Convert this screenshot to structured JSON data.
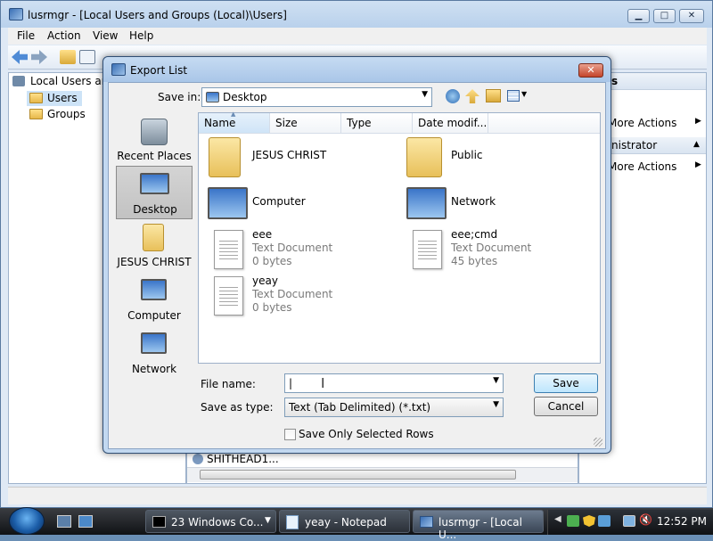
{
  "main_window": {
    "title": "lusrmgr - [Local Users and Groups (Local)\\Users]",
    "menu": [
      "File",
      "Action",
      "View",
      "Help"
    ],
    "tree": {
      "root": "Local Users and",
      "items": [
        "Users",
        "Groups"
      ]
    },
    "actions": {
      "header_1": "s",
      "more_actions_1": "More Actions",
      "header_2": "nistrator",
      "more_actions_2": "More Actions"
    },
    "center_row": "SHITHEAD1...",
    "caption_buttons": {
      "minimize": "▁",
      "maximize": "□",
      "close": "✕"
    }
  },
  "dialog": {
    "title": "Export List",
    "save_in_label": "Save in:",
    "save_in_value": "Desktop",
    "places": [
      {
        "label": "Recent Places",
        "icon": "recent-places-icon"
      },
      {
        "label": "Desktop",
        "icon": "desktop-icon",
        "selected": true
      },
      {
        "label": "JESUS CHRIST",
        "icon": "user-folder-icon"
      },
      {
        "label": "Computer",
        "icon": "computer-icon"
      },
      {
        "label": "Network",
        "icon": "network-icon"
      }
    ],
    "columns": [
      "Name",
      "Size",
      "Type",
      "Date modif..."
    ],
    "items": [
      {
        "name": "JESUS CHRIST",
        "type": "",
        "size": "",
        "icon": "user-folder-icon"
      },
      {
        "name": "Public",
        "type": "",
        "size": "",
        "icon": "folder-icon"
      },
      {
        "name": "Computer",
        "type": "",
        "size": "",
        "icon": "computer-icon"
      },
      {
        "name": "Network",
        "type": "",
        "size": "",
        "icon": "network-icon"
      },
      {
        "name": "eee",
        "type": "Text Document",
        "size": "0 bytes",
        "icon": "text-document-icon"
      },
      {
        "name": "eee;cmd",
        "type": "Text Document",
        "size": "45 bytes",
        "icon": "text-document-icon"
      },
      {
        "name": "yeay",
        "type": "Text Document",
        "size": "0 bytes",
        "icon": "text-document-icon"
      }
    ],
    "file_name_label": "File name:",
    "file_name_value": "|",
    "save_type_label": "Save as type:",
    "save_type_value": "Text (Tab Delimited) (*.txt)",
    "save_button": "Save",
    "cancel_button": "Cancel",
    "checkbox_label": "Save Only Selected Rows",
    "checkbox_checked": false
  },
  "taskbar": {
    "tasks": [
      {
        "label": "23 Windows Co...",
        "icon": "cmd-icon"
      },
      {
        "label": "yeay - Notepad",
        "icon": "notepad-icon"
      },
      {
        "label": "lusrmgr - [Local U...",
        "icon": "lusrmgr-icon",
        "active": true
      }
    ],
    "clock": "12:52 PM"
  },
  "colors": {
    "accent": "#3c7fb1",
    "dialog_frame": "#c2d8f0",
    "selection": "#c2c2c2"
  }
}
